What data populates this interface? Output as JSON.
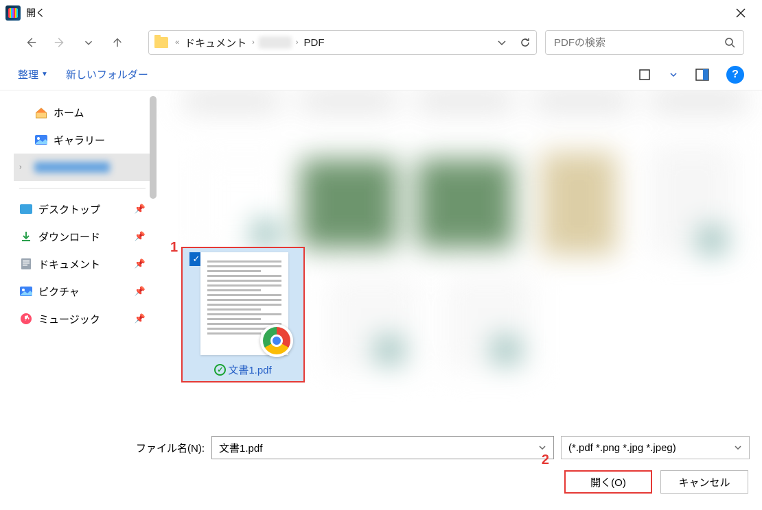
{
  "title": "開く",
  "breadcrumb": {
    "sep_pre": "«",
    "item1": "ドキュメント",
    "item3": "PDF"
  },
  "search": {
    "placeholder": "PDFの検索"
  },
  "orgbar": {
    "organize": "整理",
    "newfolder": "新しいフォルダー"
  },
  "sidebar": {
    "home": "ホーム",
    "gallery": "ギャラリー",
    "desktop": "デスクトップ",
    "downloads": "ダウンロード",
    "documents": "ドキュメント",
    "pictures": "ピクチャ",
    "music": "ミュージック"
  },
  "file": {
    "selected_name": "文書1.pdf"
  },
  "bottom": {
    "filename_label": "ファイル名(N):",
    "filename_value": "文書1.pdf",
    "filter": "(*.pdf *.png *.jpg *.jpeg)",
    "open": "開く(O)",
    "cancel": "キャンセル"
  },
  "annotations": {
    "a1": "1",
    "a2": "2"
  }
}
